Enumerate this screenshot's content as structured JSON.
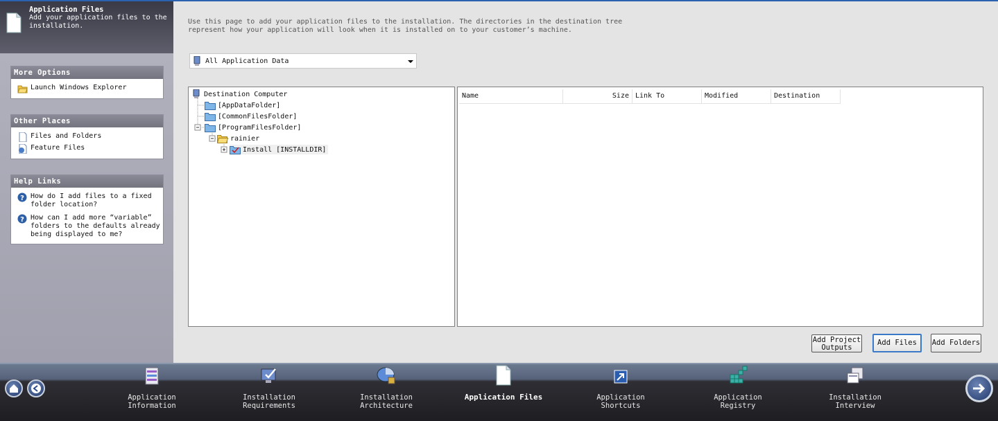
{
  "header": {
    "title": "Application Files",
    "subtitle": "Add your application files to the installation."
  },
  "sidebar": {
    "more_options": {
      "title": "More Options",
      "items": [
        {
          "label": "Launch Windows Explorer",
          "icon": "folder-explorer-icon"
        }
      ]
    },
    "other_places": {
      "title": "Other Places",
      "items": [
        {
          "label": "Files and Folders",
          "icon": "document-icon"
        },
        {
          "label": "Feature Files",
          "icon": "feature-files-icon"
        }
      ]
    },
    "help_links": {
      "title": "Help Links",
      "items": [
        {
          "label": "How do I add files to a fixed folder location?",
          "icon": "help-icon"
        },
        {
          "label": "How can I add more “variable” folders to the defaults already being displayed to me?",
          "icon": "help-icon"
        }
      ]
    }
  },
  "main": {
    "description": "Use this page to add your application files to the installation. The directories in the destination tree represent how your application will look when it is installed on to your customer’s machine.",
    "filter": {
      "selected": "All Application Data"
    },
    "tree": [
      {
        "label": "Destination Computer",
        "icon": "computer-icon"
      },
      {
        "label": "[AppDataFolder]",
        "icon": "folder-icon"
      },
      {
        "label": "[CommonFilesFolder]",
        "icon": "folder-icon"
      },
      {
        "label": "[ProgramFilesFolder]",
        "icon": "folder-icon"
      },
      {
        "label": "rainier",
        "icon": "folder-open-icon"
      },
      {
        "label": "Install [INSTALLDIR]",
        "icon": "installdir-icon"
      }
    ],
    "columns": [
      "Name",
      "Size",
      "Link To",
      "Modified",
      "Destination"
    ],
    "buttons": {
      "add_project_outputs": "Add Project Outputs",
      "add_files": "Add Files",
      "add_folders": "Add Folders"
    }
  },
  "nav": {
    "items": [
      {
        "label": "Application Information",
        "icon": "application-information-icon"
      },
      {
        "label": "Installation Requirements",
        "icon": "installation-requirements-icon"
      },
      {
        "label": "Installation Architecture",
        "icon": "installation-architecture-icon"
      },
      {
        "label": "Application Files",
        "icon": "application-files-icon",
        "active": true
      },
      {
        "label": "Application Shortcuts",
        "icon": "application-shortcuts-icon"
      },
      {
        "label": "Application Registry",
        "icon": "application-registry-icon"
      },
      {
        "label": "Installation Interview",
        "icon": "installation-interview-icon"
      }
    ]
  },
  "colors": {
    "accent": "#2a62b0",
    "selected_border": "#3a78c8",
    "folder": "#7fb6e8",
    "nav_bg": "#1e1e22"
  }
}
